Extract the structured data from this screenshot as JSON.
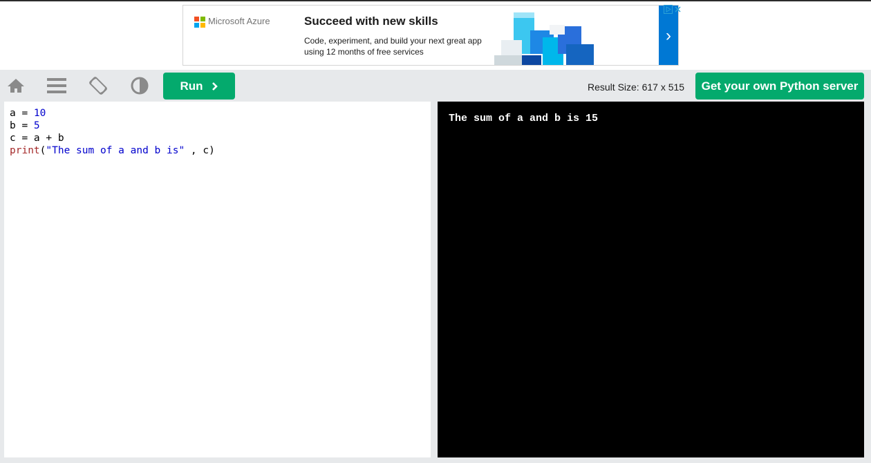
{
  "ad": {
    "brand": "Microsoft Azure",
    "title": "Succeed with new skills",
    "body": "Code, experiment, and build your next great app using 12 months of free services",
    "arrow": "›",
    "colors": {
      "red": "#f25022",
      "green": "#7fba00",
      "blue": "#00a4ef",
      "yellow": "#ffb900",
      "accent": "#0078d4"
    }
  },
  "toolbar": {
    "run_label": "Run",
    "result_size": "Result Size: 617 x 515",
    "get_server_label": "Get your own Python server",
    "accent": "#04aa6d"
  },
  "editor": {
    "lines": [
      "a = 10",
      "b = 5",
      "c = a + b",
      "print(\"The sum of a and b is\" , c)"
    ]
  },
  "result": {
    "output": "The sum of a and b is 15"
  }
}
